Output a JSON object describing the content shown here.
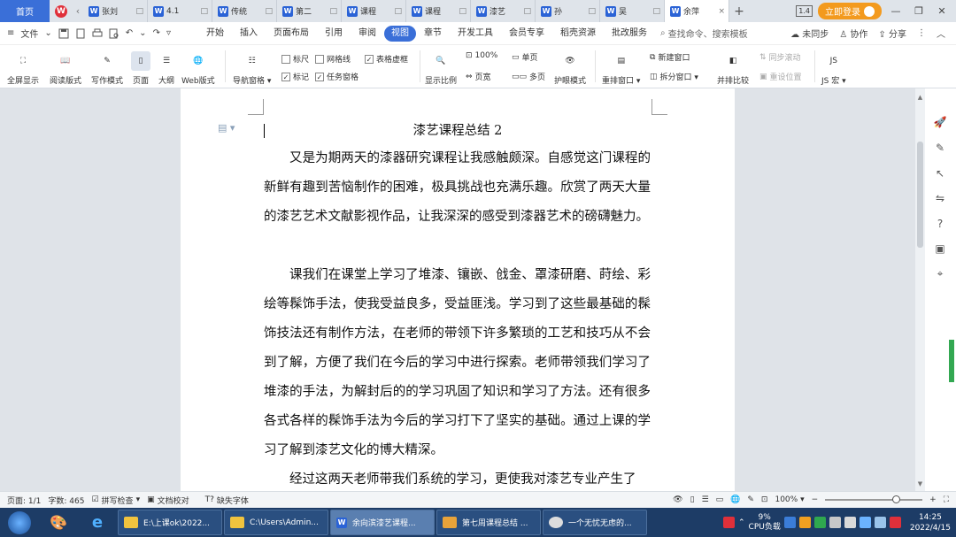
{
  "tabs": {
    "home": "首页",
    "items": [
      {
        "label": "张刘"
      },
      {
        "label": "4.1"
      },
      {
        "label": "传统"
      },
      {
        "label": "第二"
      },
      {
        "label": "课程"
      },
      {
        "label": "课程"
      },
      {
        "label": "漆艺"
      },
      {
        "label": "孙"
      },
      {
        "label": "吴"
      },
      {
        "label": "余萍",
        "active": true
      }
    ],
    "badge": "1.4",
    "login": "立即登录"
  },
  "menu": {
    "file": "文件",
    "items": [
      "开始",
      "插入",
      "页面布局",
      "引用",
      "审阅",
      "视图",
      "章节",
      "开发工具",
      "会员专享",
      "稻壳资源",
      "批改服务"
    ],
    "active": "视图",
    "search": "查找命令、搜索模板",
    "sync": "未同步",
    "collab": "协作",
    "share": "分享"
  },
  "ribbon": {
    "fullscreen": "全屏显示",
    "reading": "阅读版式",
    "writing": "写作模式",
    "page": "页面",
    "outline": "大纲",
    "web": "Web版式",
    "nav_pane": "导航窗格",
    "ruler": "标尺",
    "gridlines": "网格线",
    "table_border": "表格虚框",
    "marks": "标记",
    "task_pane": "任务窗格",
    "zoom": "显示比例",
    "zoom_value": "100%",
    "page_width": "页宽",
    "single_page": "单页",
    "multi_page": "多页",
    "eye_mode": "护眼模式",
    "rearrange": "重排窗口",
    "new_window": "新建窗口",
    "split_window": "拆分窗口",
    "side_compare": "并排比较",
    "sync_scroll": "同步滚动",
    "reset_pos": "重设位置",
    "js_macro": "JS 宏"
  },
  "document": {
    "title": "漆艺课程总结 2",
    "paragraphs": [
      "又是为期两天的漆器研究课程让我感触颇深。自感觉这门课程的新鲜有趣到苦恼制作的困难，极具挑战也充满乐趣。欣赏了两天大量的漆艺艺术文献影视作品，让我深深的感受到漆器艺术的磅礴魅力。",
      "课我们在课堂上学习了堆漆、镶嵌、戗金、罩漆研磨、莳绘、彩绘等髹饰手法，使我受益良多，受益匪浅。学习到了这些最基础的髹饰技法还有制作方法，在老师的带领下许多繁琐的工艺和技巧从不会到了解，方便了我们在今后的学习中进行探索。老师带领我们学习了堆漆的手法，为解封后的的学习巩固了知识和学习了方法。还有很多各式各样的髹饰手法为今后的学习打下了坚实的基础。通过上课的学习了解到漆艺文化的博大精深。",
      "经过这两天老师带我们系统的学习，更使我对漆艺专业产生了"
    ]
  },
  "status": {
    "page": "页面: 1/1",
    "words": "字数: 465",
    "spell": "拼写检查",
    "proof": "文档校对",
    "font_missing": "缺失字体",
    "zoom": "100%"
  },
  "taskbar": {
    "tasks": [
      {
        "label": "E:\\上课ok\\2022..."
      },
      {
        "label": "C:\\Users\\Admin..."
      },
      {
        "label": "余向滨漆艺课程...",
        "active": true
      },
      {
        "label": "第七周课程总结 ..."
      },
      {
        "label": "一个无忧无虑的..."
      }
    ],
    "cpu_percent": "9%",
    "cpu_label": "CPU负载",
    "time": "14:25",
    "date": "2022/4/15"
  }
}
